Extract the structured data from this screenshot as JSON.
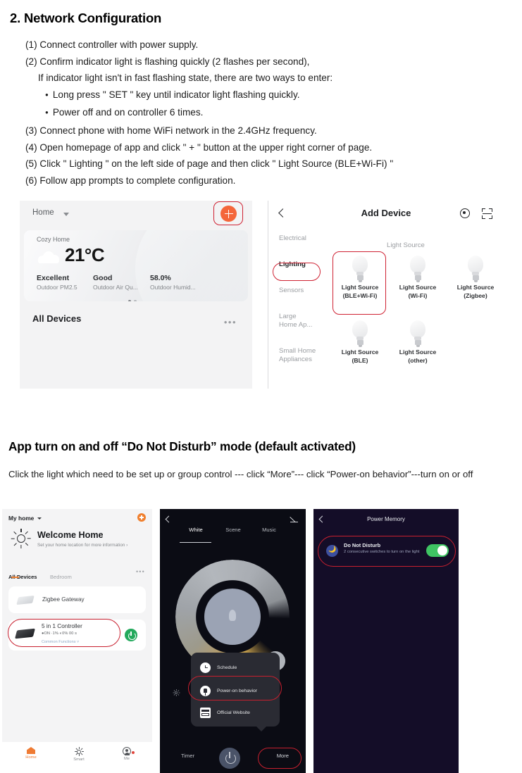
{
  "section": {
    "title": "2. Network Configuration",
    "steps": [
      {
        "text": "(1) Connect controller with power supply.",
        "style": "normal"
      },
      {
        "text": "(2) Confirm indicator light is flashing quickly (2 flashes per second),",
        "style": "normal"
      },
      {
        "text": "If indicator light isn't in fast flashing state, there are two ways to enter:",
        "style": "indent"
      },
      {
        "text": "Long press \" SET \" key until indicator light flashing quickly.",
        "style": "bullet"
      },
      {
        "text": "Power off and on controller 6 times.",
        "style": "bullet"
      },
      {
        "text": "(3) Connect phone with home WiFi network in the 2.4GHz frequency.",
        "style": "normal"
      },
      {
        "text": "(4) Open homepage of app and click \" + \" button at the upper right corner of page.",
        "style": "normal"
      },
      {
        "text": "(5) Click \" Lighting \" on the left side of page and then click \" Light Source (BLE+Wi-Fi) \"",
        "style": "normal"
      },
      {
        "text": "(6) Follow app prompts to complete configuration.",
        "style": "normal"
      }
    ]
  },
  "home_screen": {
    "home_label": "Home",
    "weather": {
      "place": "Cozy Home",
      "temperature": "21°C",
      "metrics": [
        {
          "value": "Excellent",
          "label": "Outdoor PM2.5"
        },
        {
          "value": "Good",
          "label": "Outdoor Air Qu..."
        },
        {
          "value": "58.0%",
          "label": "Outdoor Humid..."
        }
      ]
    },
    "all_devices": "All Devices",
    "more_dots": "•••"
  },
  "add_device": {
    "title": "Add Device",
    "categories": [
      {
        "label": "Electrical",
        "active": false
      },
      {
        "label": "Lighting",
        "active": true
      },
      {
        "label": "Sensors",
        "active": false
      },
      {
        "label": "Large\nHome Ap...",
        "active": false
      },
      {
        "label": "Small Home\nAppliances",
        "active": false
      }
    ],
    "group_header": "Light Source",
    "tiles": [
      {
        "line1": "Light Source",
        "line2": "(BLE+Wi-Fi)",
        "highlighted": true
      },
      {
        "line1": "Light Source",
        "line2": "(Wi-Fi)",
        "highlighted": false
      },
      {
        "line1": "Light Source",
        "line2": "(Zigbee)",
        "highlighted": false
      },
      {
        "line1": "Light Source",
        "line2": "(BLE)",
        "highlighted": false
      },
      {
        "line1": "Light Source",
        "line2": "(other)",
        "highlighted": false
      }
    ]
  },
  "dnd_section": {
    "heading": "App turn on and off “Do Not Disturb” mode (default activated)",
    "description": "Click the light which need to be set up or group control --- click “More”--- click “Power-on behavior”---turn on or off"
  },
  "phone1": {
    "my_home": "My home",
    "welcome_title": "Welcome Home",
    "welcome_sub": "Set your home location for more information  ›",
    "tabs": [
      {
        "label": "All Devices",
        "active": true
      },
      {
        "label": "Bedroom",
        "active": false
      }
    ],
    "more_dots": "•••",
    "devices": [
      {
        "name": "Zigbee Gateway"
      },
      {
        "name": "5 in 1 Controller",
        "stats": "●ON  ·1%  ◐0%  00 s",
        "common": "Common Functions ˅"
      }
    ],
    "nav": [
      {
        "label": "Home",
        "active": true
      },
      {
        "label": "Smart",
        "active": false
      },
      {
        "label": "Me",
        "active": false
      }
    ]
  },
  "phone2": {
    "tabs": [
      {
        "label": "White",
        "active": true
      },
      {
        "label": "Scene",
        "active": false
      },
      {
        "label": "Music",
        "active": false
      }
    ],
    "popup_items": [
      {
        "label": "Schedule",
        "icon": "clock-icon"
      },
      {
        "label": "Power-on behavior",
        "icon": "plug-icon"
      },
      {
        "label": "Official Website",
        "icon": "website-icon"
      }
    ],
    "bottom": {
      "timer": "Timer",
      "more": "More"
    }
  },
  "phone3": {
    "title": "Power Memory",
    "dnd": {
      "title": "Do Not Disturb",
      "subtitle": "2 consecutive switches to turn on the light",
      "toggle_on": true
    }
  },
  "colors": {
    "accent_red": "#cf2233",
    "orange": "#f4663a",
    "green": "#3fc463"
  }
}
